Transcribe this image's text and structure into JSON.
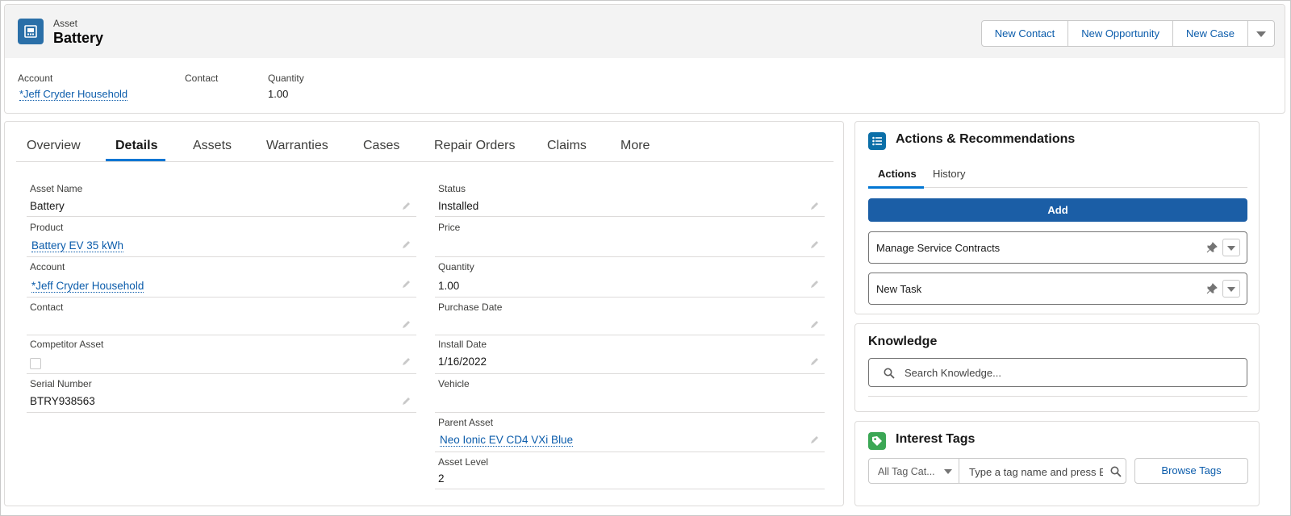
{
  "header": {
    "object_type": "Asset",
    "record_name": "Battery",
    "icon": "asset-icon",
    "buttons": [
      "New Contact",
      "New Opportunity",
      "New Case"
    ],
    "highlights": [
      {
        "label": "Account",
        "value": "*Jeff Cryder Household"
      },
      {
        "label": "Contact",
        "value": ""
      },
      {
        "label": "Quantity",
        "value": "1.00"
      }
    ]
  },
  "tabs": [
    "Overview",
    "Details",
    "Assets",
    "Warranties",
    "Cases",
    "Repair Orders",
    "Claims",
    "More"
  ],
  "active_tab": "Details",
  "details": {
    "left": [
      {
        "label": "Asset Name",
        "value": "Battery"
      },
      {
        "label": "Product",
        "value": "Battery EV 35 kWh"
      },
      {
        "label": "Account",
        "value": "*Jeff Cryder Household"
      },
      {
        "label": "Contact",
        "value": ""
      },
      {
        "label": "Competitor Asset",
        "value": ""
      },
      {
        "label": "Serial Number",
        "value": "BTRY938563"
      }
    ],
    "right": [
      {
        "label": "Status",
        "value": "Installed"
      },
      {
        "label": "Price",
        "value": ""
      },
      {
        "label": "Quantity",
        "value": "1.00"
      },
      {
        "label": "Purchase Date",
        "value": ""
      },
      {
        "label": "Install Date",
        "value": "1/16/2022"
      },
      {
        "label": "Vehicle",
        "value": ""
      },
      {
        "label": "Parent Asset",
        "value": "Neo Ionic EV CD4 VXi Blue"
      },
      {
        "label": "Asset Level",
        "value": "2"
      }
    ]
  },
  "actions_card": {
    "title": "Actions & Recommendations",
    "tabs": [
      "Actions",
      "History"
    ],
    "add_label": "Add",
    "items": [
      "Manage Service Contracts",
      "New Task"
    ]
  },
  "knowledge_card": {
    "title": "Knowledge",
    "search_placeholder": "Search Knowledge..."
  },
  "tags_card": {
    "title": "Interest Tags",
    "category_value": "All Tag Cat...",
    "input_placeholder": "Type a tag name and press E",
    "browse_label": "Browse Tags"
  },
  "colors": {
    "brand_blue": "#1b5ea6",
    "link": "#0b5cab",
    "tab_underline": "#0176d3",
    "asset_icon": "#2a6fa8",
    "actions_icon": "#0b6fa8",
    "tags_icon": "#3ba755"
  }
}
